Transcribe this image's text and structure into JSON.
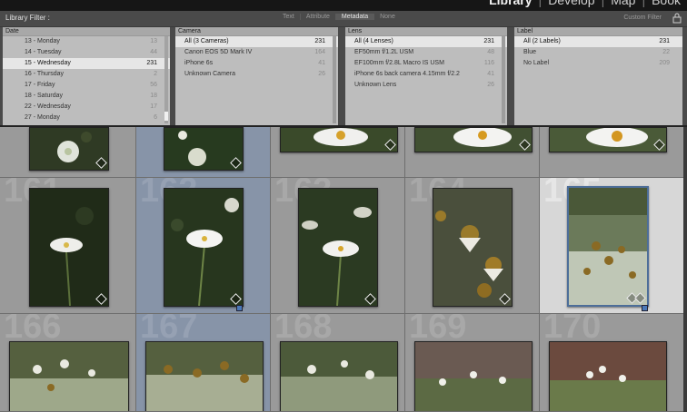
{
  "modules": {
    "items": [
      "Library",
      "Develop",
      "Map",
      "Book"
    ],
    "active": "Library"
  },
  "filter_bar": {
    "title": "Library Filter :",
    "tabs": [
      "Text",
      "Attribute",
      "Metadata",
      "None"
    ],
    "active_tab": "Metadata",
    "preset": "Custom Filter"
  },
  "columns": {
    "date": {
      "header": "Date",
      "rows": [
        {
          "label": "13 - Monday",
          "count": "13"
        },
        {
          "label": "14 - Tuesday",
          "count": "44"
        },
        {
          "label": "15 - Wednesday",
          "count": "231"
        },
        {
          "label": "16 - Thursday",
          "count": "2"
        },
        {
          "label": "17 - Friday",
          "count": "56"
        },
        {
          "label": "18 - Saturday",
          "count": "18"
        },
        {
          "label": "22 - Wednesday",
          "count": "17"
        },
        {
          "label": "27 - Monday",
          "count": "6"
        }
      ],
      "selected_index": 2
    },
    "camera": {
      "header": "Camera",
      "rows": [
        {
          "label": "All (3 Cameras)",
          "count": "231"
        },
        {
          "label": "Canon EOS 5D Mark IV",
          "count": "164"
        },
        {
          "label": "iPhone 6s",
          "count": "41"
        },
        {
          "label": "Unknown Camera",
          "count": "26"
        }
      ],
      "selected_index": 0
    },
    "lens": {
      "header": "Lens",
      "rows": [
        {
          "label": "All (4 Lenses)",
          "count": "231"
        },
        {
          "label": "EF50mm f/1.2L USM",
          "count": "48"
        },
        {
          "label": "EF100mm f/2.8L Macro IS USM",
          "count": "116"
        },
        {
          "label": "iPhone 6s back camera 4.15mm f/2.2",
          "count": "41"
        },
        {
          "label": "Unknown Lens",
          "count": "26"
        }
      ],
      "selected_index": 0
    },
    "label": {
      "header": "Label",
      "rows": [
        {
          "label": "All (2 Labels)",
          "count": "231"
        },
        {
          "label": "Blue",
          "count": "22"
        },
        {
          "label": "No Label",
          "count": "209"
        }
      ],
      "selected_index": 0
    }
  },
  "grid": {
    "row2_numbers": [
      "161",
      "162",
      "163",
      "164",
      "165"
    ],
    "row3_numbers": [
      "166",
      "167",
      "168",
      "169",
      "170"
    ]
  },
  "colors": {
    "selected_blue": "#8794a8",
    "selected_white": "#d7d7d7",
    "cell_gray": "#9a9a9a"
  }
}
